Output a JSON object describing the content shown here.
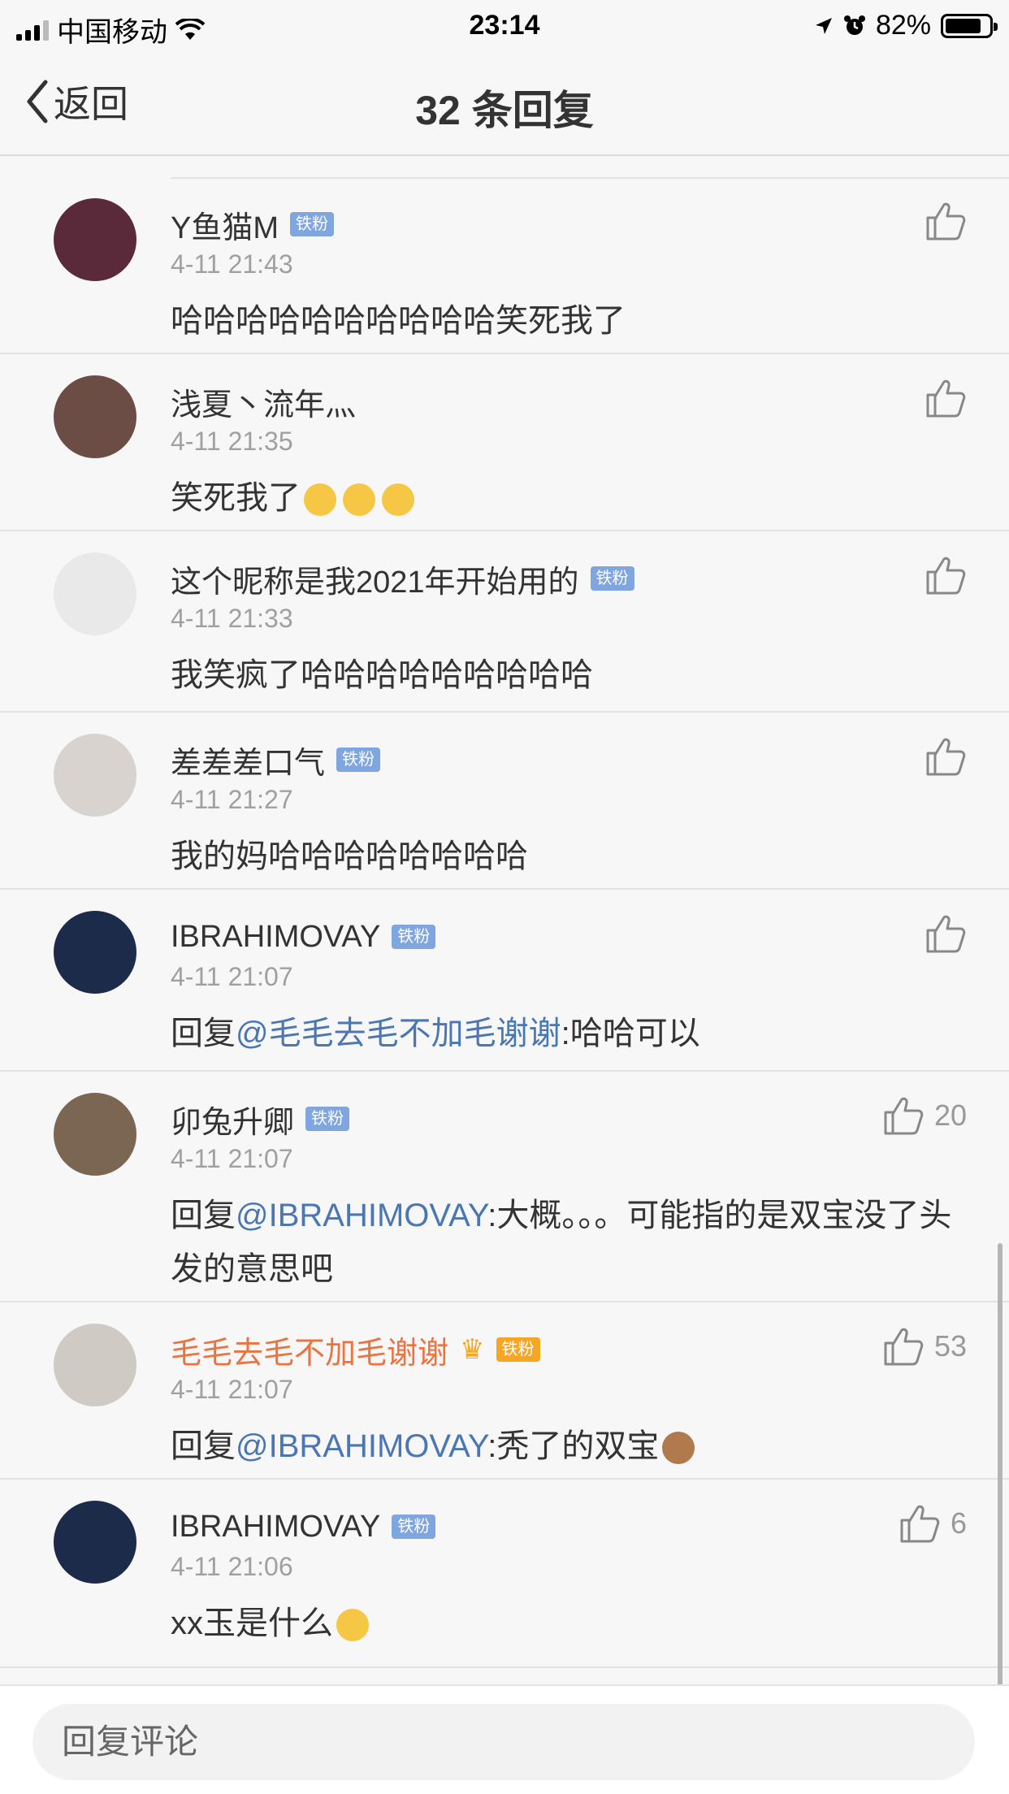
{
  "status_bar": {
    "carrier": "中国移动",
    "time": "23:14",
    "battery": "82%",
    "battery_level": 0.82
  },
  "nav": {
    "back_label": "返回",
    "title": "32 条回复"
  },
  "comments": [
    {
      "name": "Y鱼猫M",
      "badge": "铁粉",
      "time": "4-11 21:43",
      "text": "哈哈哈哈哈哈哈哈哈哈笑死我了",
      "likes": "",
      "avatar_color": "#5a2a3a"
    },
    {
      "name": "浅夏丶流年灬",
      "badge": "",
      "time": "4-11 21:35",
      "text": "笑死我了",
      "likes": "",
      "avatar_color": "#6b4d46"
    },
    {
      "name": "这个昵称是我2021年开始用的",
      "badge": "铁粉",
      "time": "4-11 21:33",
      "text": "我笑疯了哈哈哈哈哈哈哈哈哈",
      "likes": "",
      "avatar_color": "#e9e9e9"
    },
    {
      "name": "差差差口气",
      "badge": "铁粉",
      "time": "4-11 21:27",
      "text": "我的妈哈哈哈哈哈哈哈哈",
      "likes": "",
      "avatar_color": "#d8d3cf"
    },
    {
      "name": "IBRAHIMOVAY",
      "badge": "铁粉",
      "time": "4-11 21:07",
      "reply_prefix": "回复",
      "mention": "@毛毛去毛不加毛谢谢",
      "text": ":哈哈可以",
      "likes": "",
      "avatar_color": "#1d2b4a"
    },
    {
      "name": "卯兔升卿",
      "badge": "铁粉",
      "time": "4-11 21:07",
      "reply_prefix": "回复",
      "mention": "@IBRAHIMOVAY",
      "text": ":大概。。。可能指的是双宝没了头发的意思吧",
      "likes": "20",
      "avatar_color": "#7a6653"
    },
    {
      "name": "毛毛去毛不加毛谢谢",
      "badge": "铁粉",
      "time": "4-11 21:07",
      "reply_prefix": "回复",
      "mention": "@IBRAHIMOVAY",
      "text": ":秃了的双宝",
      "likes": "53",
      "avatar_color": "#cfcac3"
    },
    {
      "name": "IBRAHIMOVAY",
      "badge": "铁粉",
      "time": "4-11 21:06",
      "text": "xx玉是什么",
      "likes": "6",
      "avatar_color": "#1d2b4a"
    }
  ],
  "input": {
    "placeholder": "回复评论"
  }
}
